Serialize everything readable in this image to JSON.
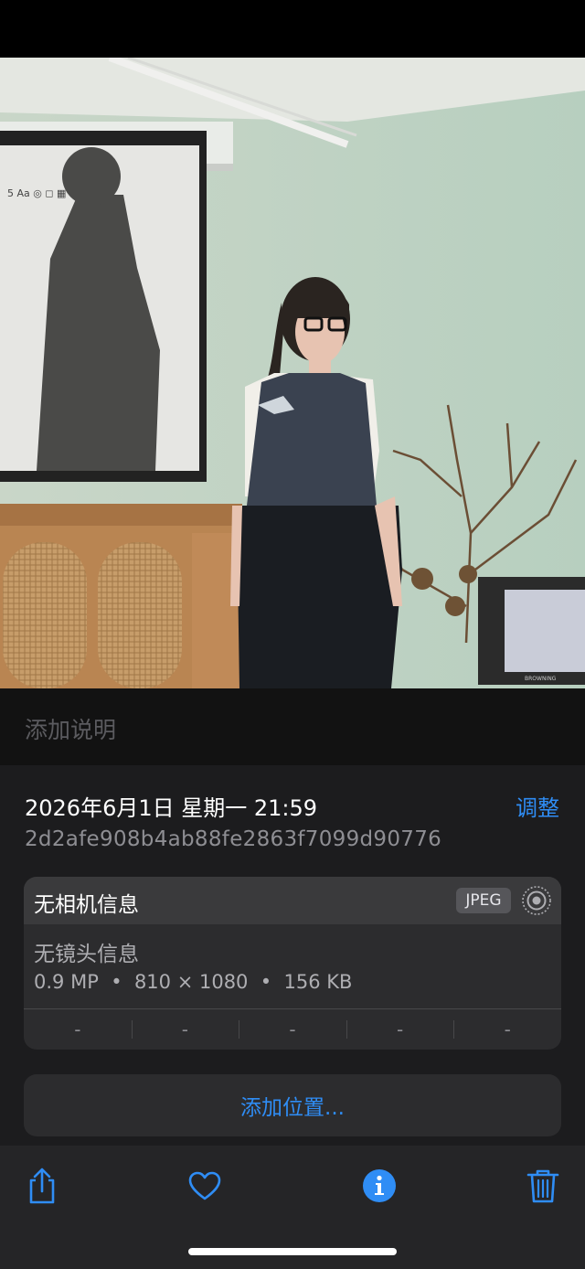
{
  "photo": {
    "alt_screen_text": "5 Aa ◎ ◻ ▦",
    "monitor_brand": "BROWNING"
  },
  "caption": {
    "placeholder": "添加说明"
  },
  "info": {
    "datetime": "2026年6月1日 星期一 21:59",
    "adjust_label": "调整",
    "filename": "2d2afe908b4ab88fe2863f7099d90776"
  },
  "camera": {
    "title": "无相机信息",
    "format": "JPEG",
    "lens": "无镜头信息",
    "specs": "0.9 MP  •  810 × 1080  •  156 KB",
    "exif": [
      "-",
      "-",
      "-",
      "-",
      "-"
    ]
  },
  "location": {
    "add_label": "添加位置..."
  },
  "toolbar": {
    "items": [
      {
        "icon": "share-icon"
      },
      {
        "icon": "heart-icon"
      },
      {
        "icon": "info-icon"
      },
      {
        "icon": "trash-icon"
      }
    ]
  },
  "colors": {
    "accent": "#2f8df5",
    "sheet": "#1c1c1e",
    "card": "#2c2c2e"
  }
}
